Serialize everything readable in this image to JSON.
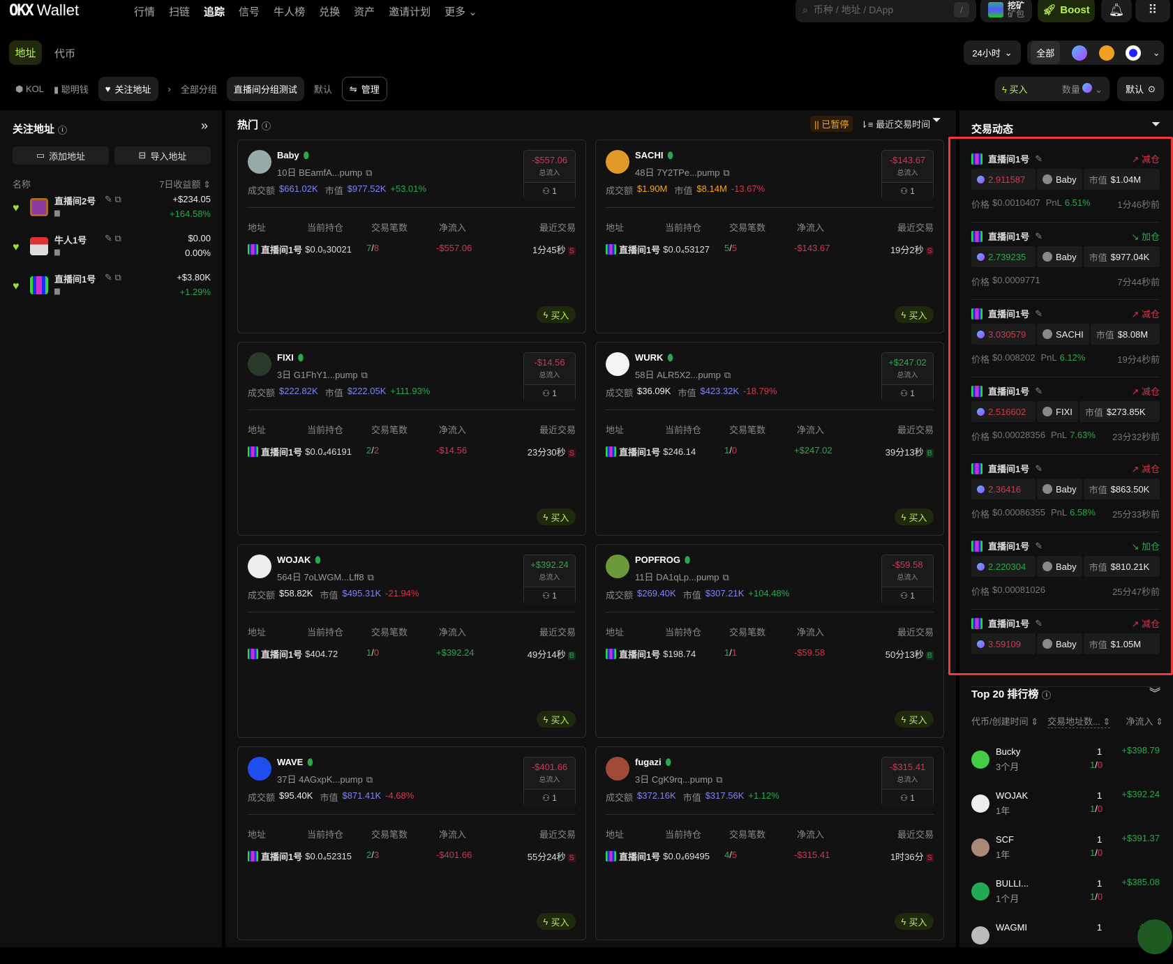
{
  "nav": {
    "logo": "OKX",
    "wallet": "Wallet",
    "items": [
      "行情",
      "扫链",
      "追踪",
      "信号",
      "牛人榜",
      "兑换",
      "资产",
      "邀请计划",
      "更多 ⌄"
    ],
    "active_index": 2,
    "search_placeholder": "币种 / 地址 / DApp",
    "search_shortcut": "/",
    "mining_title": "挖矿",
    "mining_sub": "矿包",
    "boost": "Boost"
  },
  "tabs": {
    "address": "地址",
    "token": "代币"
  },
  "subnav": {
    "kol": "KOL",
    "smart": "聪明钱",
    "follow": "关注地址",
    "all_groups": "全部分组",
    "group_test": "直播间分组测试",
    "default": "默认",
    "manage": "管理"
  },
  "filters": {
    "time": "24小时",
    "all": "全部",
    "buy": "买入",
    "amount": "数量",
    "preset": "默认"
  },
  "sidebar": {
    "title": "关注地址",
    "add": "添加地址",
    "import": "导入地址",
    "col_name": "名称",
    "col_pnl": "7日收益额",
    "items": [
      {
        "name": "直播间2号",
        "value": "+$234.05",
        "pct": "+164.58%",
        "pct_color": "g"
      },
      {
        "name": "牛人1号",
        "value": "$0.00",
        "pct": "0.00%",
        "pct_color": "w"
      },
      {
        "name": "直播间1号",
        "value": "+$3.80K",
        "pct": "+1.29%",
        "pct_color": "g"
      }
    ]
  },
  "main": {
    "title": "热门",
    "paused": "|| 已暂停",
    "sort": "最近交易时间",
    "headers": [
      "地址",
      "当前持仓",
      "交易笔数",
      "净流入",
      "最近交易"
    ],
    "flow_label": "总流入",
    "buy": "买入",
    "vol_label": "成交额",
    "mc_label": "市值",
    "cards": [
      {
        "name": "Baby",
        "age": "10日",
        "addr": "BEamfA...pump",
        "vol": "$661.02K",
        "vol_c": "b",
        "mc": "$977.52K",
        "mc_c": "b",
        "chg": "+53.01%",
        "chg_c": "g",
        "flow": "-$557.06",
        "flow_c": "r",
        "holders": "1",
        "avatar": "#9aa",
        "row": {
          "wallet": "直播间1号",
          "hold": "$0.0₅30021",
          "buys": "7",
          "sells": "8",
          "net": "-$557.06",
          "net_c": "r",
          "time": "1分45秒",
          "side": "S"
        }
      },
      {
        "name": "SACHI",
        "age": "48日",
        "addr": "7Y2TPe...pump",
        "vol": "$1.90M",
        "vol_c": "o",
        "mc": "$8.14M",
        "mc_c": "o",
        "chg": "-13.67%",
        "chg_c": "r",
        "flow": "-$143.67",
        "flow_c": "r",
        "holders": "1",
        "avatar": "#e09a2a",
        "row": {
          "wallet": "直播间1号",
          "hold": "$0.0₄53127",
          "buys": "5",
          "sells": "5",
          "net": "-$143.67",
          "net_c": "r",
          "time": "19分2秒",
          "side": "S"
        }
      },
      {
        "name": "FIXI",
        "age": "3日",
        "addr": "G1FhY1...pump",
        "vol": "$222.82K",
        "vol_c": "b",
        "mc": "$222.05K",
        "mc_c": "b",
        "chg": "+111.93%",
        "chg_c": "g",
        "flow": "-$14.56",
        "flow_c": "r",
        "holders": "1",
        "avatar": "#2a3a2a",
        "row": {
          "wallet": "直播间1号",
          "hold": "$0.0₄46191",
          "buys": "2",
          "sells": "2",
          "net": "-$14.56",
          "net_c": "r",
          "time": "23分30秒",
          "side": "S"
        }
      },
      {
        "name": "WURK",
        "age": "58日",
        "addr": "ALR5X2...pump",
        "vol": "$36.09K",
        "vol_c": "w",
        "mc": "$423.32K",
        "mc_c": "b",
        "chg": "-18.79%",
        "chg_c": "r",
        "flow": "+$247.02",
        "flow_c": "g",
        "holders": "1",
        "avatar": "#f4f4f4",
        "row": {
          "wallet": "直播间1号",
          "hold": "$246.14",
          "buys": "1",
          "sells": "0",
          "net": "+$247.02",
          "net_c": "g",
          "time": "39分13秒",
          "side": "B"
        }
      },
      {
        "name": "WOJAK",
        "age": "564日",
        "addr": "7oLWGM...Lff8",
        "vol": "$58.82K",
        "vol_c": "w",
        "mc": "$495.31K",
        "mc_c": "b",
        "chg": "-21.94%",
        "chg_c": "r",
        "flow": "+$392.24",
        "flow_c": "g",
        "holders": "1",
        "avatar": "#eee",
        "row": {
          "wallet": "直播间1号",
          "hold": "$404.72",
          "buys": "1",
          "sells": "0",
          "net": "+$392.24",
          "net_c": "g",
          "time": "49分14秒",
          "side": "B"
        }
      },
      {
        "name": "POPFROG",
        "age": "11日",
        "addr": "DA1qLp...pump",
        "vol": "$269.40K",
        "vol_c": "b",
        "mc": "$307.21K",
        "mc_c": "b",
        "chg": "+104.48%",
        "chg_c": "g",
        "flow": "-$59.58",
        "flow_c": "r",
        "holders": "1",
        "avatar": "#6a9a3a",
        "row": {
          "wallet": "直播间1号",
          "hold": "$198.74",
          "buys": "1",
          "sells": "1",
          "net": "-$59.58",
          "net_c": "r",
          "time": "50分13秒",
          "side": "B"
        }
      },
      {
        "name": "WAVE",
        "age": "37日",
        "addr": "4AGxpK...pump",
        "vol": "$95.40K",
        "vol_c": "w",
        "mc": "$871.41K",
        "mc_c": "b",
        "chg": "-4.68%",
        "chg_c": "r",
        "flow": "-$401.66",
        "flow_c": "r",
        "holders": "1",
        "avatar": "#1f4ef0",
        "row": {
          "wallet": "直播间1号",
          "hold": "$0.0₄52315",
          "buys": "2",
          "sells": "3",
          "net": "-$401.66",
          "net_c": "r",
          "time": "55分24秒",
          "side": "S"
        }
      },
      {
        "name": "fugazi",
        "age": "3日",
        "addr": "CgK9rq...pump",
        "vol": "$372.16K",
        "vol_c": "b",
        "mc": "$317.56K",
        "mc_c": "b",
        "chg": "+1.12%",
        "chg_c": "g",
        "flow": "-$315.41",
        "flow_c": "r",
        "holders": "1",
        "avatar": "#a04a3a",
        "row": {
          "wallet": "直播间1号",
          "hold": "$0.0₄69495",
          "buys": "4",
          "sells": "5",
          "net": "-$315.41",
          "net_c": "r",
          "time": "1时36分",
          "side": "S"
        }
      }
    ]
  },
  "activity": {
    "title": "交易动态",
    "mc_label": "市值",
    "price_label": "价格",
    "pnl_label": "PnL",
    "items": [
      {
        "wallet": "直播间1号",
        "action": "↗ 减仓",
        "action_c": "r",
        "amount": "2.911587",
        "amount_c": "r",
        "token": "Baby",
        "mc": "$1.04M",
        "price": "$0.0010407",
        "pnl": "6.51%",
        "time": "1分46秒前"
      },
      {
        "wallet": "直播间1号",
        "action": "↘ 加仓",
        "action_c": "g",
        "amount": "2.739235",
        "amount_c": "g",
        "token": "Baby",
        "mc": "$977.04K",
        "price": "$0.0009771",
        "pnl": null,
        "time": "7分44秒前"
      },
      {
        "wallet": "直播间1号",
        "action": "↗ 减仓",
        "action_c": "r",
        "amount": "3.030579",
        "amount_c": "r",
        "token": "SACHI",
        "mc": "$8.08M",
        "price": "$0.008202",
        "pnl": "6.12%",
        "time": "19分4秒前"
      },
      {
        "wallet": "直播间1号",
        "action": "↗ 减仓",
        "action_c": "r",
        "amount": "2.516602",
        "amount_c": "r",
        "token": "FIXI",
        "mc": "$273.85K",
        "price": "$0.00028356",
        "pnl": "7.63%",
        "time": "23分32秒前"
      },
      {
        "wallet": "直播间1号",
        "action": "↗ 减仓",
        "action_c": "r",
        "amount": "2.36416",
        "amount_c": "r",
        "token": "Baby",
        "mc": "$863.50K",
        "price": "$0.00086355",
        "pnl": "6.58%",
        "time": "25分33秒前"
      },
      {
        "wallet": "直播间1号",
        "action": "↘ 加仓",
        "action_c": "g",
        "amount": "2.220304",
        "amount_c": "g",
        "token": "Baby",
        "mc": "$810.21K",
        "price": "$0.00081026",
        "pnl": null,
        "time": "25分47秒前"
      },
      {
        "wallet": "直播间1号",
        "action": "↗ 减仓",
        "action_c": "r",
        "amount": "3.59109",
        "amount_c": "r",
        "token": "Baby",
        "mc": "$1.05M",
        "price": null,
        "pnl": null,
        "time": null
      }
    ]
  },
  "ranking": {
    "title": "Top 20 排行榜",
    "col1": "代币/创建时间",
    "col2": "交易地址数...",
    "col3": "净流入",
    "items": [
      {
        "name": "Bucky",
        "age": "3个月",
        "count": "1",
        "buys": "1",
        "sells": "0",
        "net": "+$398.79",
        "avatar": "#4c4"
      },
      {
        "name": "WOJAK",
        "age": "1年",
        "count": "1",
        "buys": "1",
        "sells": "0",
        "net": "+$392.24",
        "avatar": "#eee"
      },
      {
        "name": "SCF",
        "age": "1年",
        "count": "1",
        "buys": "1",
        "sells": "0",
        "net": "+$391.37",
        "avatar": "#a87"
      },
      {
        "name": "BULLI...",
        "age": "1个月",
        "count": "1",
        "buys": "1",
        "sells": "0",
        "net": "+$385.08",
        "avatar": "#2a5"
      },
      {
        "name": "WAGMI",
        "age": "",
        "count": "1",
        "buys": "",
        "sells": "",
        "net": "+$37",
        "avatar": "#bbb"
      }
    ]
  }
}
